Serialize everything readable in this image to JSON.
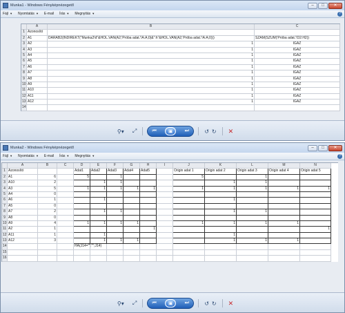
{
  "menu": {
    "file": "Fájl",
    "print": "Nyomtatás",
    "email": "E-mail",
    "burn": "Írás",
    "open": "Megnyitás"
  },
  "window1": {
    "title": "Munka1 - Windows Fényképnézegető",
    "columns": [
      "A",
      "B",
      "C"
    ],
    "rows": [
      [
        "1",
        "Azonosító",
        "",
        ""
      ],
      [
        "2",
        "A1",
        "DARAB2(INDIREKT(\"Munka2!d\"&HOL.VAN(A2;'Próba adat.'!A:A;0)&\":h\"&HOL.VAN(A2;'Próba adat.'!A:A;0)))",
        "SZÁM(SZUM('Próba adat.'!D2:H2))"
      ],
      [
        "3",
        "A2",
        "1",
        "IGAZ"
      ],
      [
        "4",
        "A3",
        "1",
        "IGAZ"
      ],
      [
        "5",
        "A4",
        "1",
        "IGAZ"
      ],
      [
        "6",
        "A5",
        "1",
        "IGAZ"
      ],
      [
        "7",
        "A6",
        "1",
        "IGAZ"
      ],
      [
        "8",
        "A7",
        "1",
        "IGAZ"
      ],
      [
        "9",
        "A8",
        "1",
        "IGAZ"
      ],
      [
        "10",
        "A9",
        "1",
        "IGAZ"
      ],
      [
        "11",
        "A10",
        "1",
        "IGAZ"
      ],
      [
        "12",
        "A11",
        "1",
        "IGAZ"
      ],
      [
        "13",
        "A12",
        "1",
        "IGAZ"
      ],
      [
        "14",
        "",
        "",
        ""
      ]
    ]
  },
  "window2": {
    "title": "Munka2 - Windows Fényképnézegető",
    "columns": [
      "A",
      "B",
      "C",
      "D",
      "E",
      "F",
      "G",
      "H",
      "I",
      "J",
      "K",
      "L",
      "M",
      "N"
    ],
    "header": [
      "Azonosító",
      "",
      "",
      "Adat1",
      "Adat2",
      "Adat3",
      "Adat4",
      "Adat5",
      "",
      "Origin adat 1",
      "Origin adat 2",
      "Origin adat 3",
      "Origin adat 4",
      "Origin adat 5"
    ],
    "rows": [
      [
        "A1",
        "6",
        "",
        "5",
        "",
        "1",
        "",
        "",
        "",
        "5",
        "",
        "1",
        "",
        ""
      ],
      [
        "A10",
        "2",
        "",
        "",
        "1",
        "1",
        "",
        "",
        "",
        "",
        "1",
        "1",
        "",
        ""
      ],
      [
        "A3",
        "5",
        "",
        "1",
        "1",
        "1",
        "1",
        "1",
        "",
        "1",
        "1",
        "1",
        "1",
        "1"
      ],
      [
        "A4",
        "0",
        "",
        "",
        "",
        "",
        "",
        "",
        "",
        "",
        "",
        "",
        "",
        ""
      ],
      [
        "A6",
        "1",
        "",
        "",
        "1",
        "",
        "",
        "",
        "",
        "",
        "1",
        "",
        "",
        ""
      ],
      [
        "A5",
        "0",
        "",
        "",
        "",
        "",
        "",
        "",
        "",
        "",
        "",
        "",
        "",
        ""
      ],
      [
        "A7",
        "2",
        "",
        "",
        "1",
        "1",
        "",
        "",
        "",
        "",
        "1",
        "1",
        "",
        ""
      ],
      [
        "A8",
        "0",
        "",
        "",
        "",
        "",
        "",
        "",
        "",
        "",
        "",
        "",
        "",
        ""
      ],
      [
        "A9",
        "4",
        "",
        "1",
        "1",
        "1",
        "1",
        "",
        "",
        "1",
        "1",
        "1",
        "1",
        ""
      ],
      [
        "A2",
        "1",
        "",
        "",
        "",
        "",
        "",
        "1",
        "",
        "",
        "",
        "",
        "",
        "1"
      ],
      [
        "A11",
        "1",
        "",
        "",
        "1",
        "",
        "",
        "",
        "",
        "",
        "1",
        "",
        "",
        ""
      ],
      [
        "A12",
        "3",
        "",
        "",
        "1",
        "1",
        "1",
        "",
        "",
        "",
        "1",
        "1",
        "1",
        ""
      ]
    ],
    "formula_note": "HA(J14=\"\";\"\";J14)"
  },
  "nav_icons": [
    "zoom-icon",
    "fit-icon",
    "prev-icon",
    "slideshow-icon",
    "next-icon",
    "rotate-left-icon",
    "rotate-right-icon",
    "delete-icon"
  ]
}
